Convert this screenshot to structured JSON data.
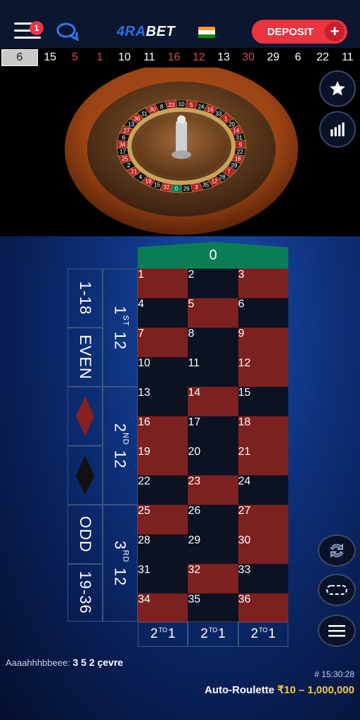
{
  "header": {
    "menu_badge": "1",
    "logo_prefix": "4RA",
    "logo_suffix": "BET",
    "deposit_label": "DEPOSIT",
    "deposit_plus": "+",
    "flag_colors": [
      "#ff9933",
      "#ffffff",
      "#138808"
    ]
  },
  "history": [
    {
      "v": "6",
      "c": "black"
    },
    {
      "v": "15",
      "c": "black"
    },
    {
      "v": "5",
      "c": "red"
    },
    {
      "v": "1",
      "c": "red"
    },
    {
      "v": "10",
      "c": "black"
    },
    {
      "v": "11",
      "c": "black"
    },
    {
      "v": "16",
      "c": "red"
    },
    {
      "v": "12",
      "c": "red"
    },
    {
      "v": "13",
      "c": "black"
    },
    {
      "v": "30",
      "c": "red"
    },
    {
      "v": "29",
      "c": "black"
    },
    {
      "v": "6",
      "c": "black"
    },
    {
      "v": "22",
      "c": "black"
    },
    {
      "v": "11",
      "c": "black"
    }
  ],
  "wheel": {
    "visible_numbers": [
      "10",
      "5",
      "24",
      "16",
      "33",
      "1",
      "20",
      "14",
      "31",
      "9",
      "22",
      "18",
      "29",
      "7",
      "28",
      "12",
      "35",
      "3",
      "26",
      "0",
      "32",
      "15",
      "19",
      "4",
      "21",
      "2",
      "25",
      "17",
      "34",
      "6",
      "27",
      "13",
      "36",
      "11",
      "30",
      "8",
      "23"
    ]
  },
  "table": {
    "zero": "0",
    "numbers": [
      {
        "n": "1",
        "c": "red"
      },
      {
        "n": "2",
        "c": "black"
      },
      {
        "n": "3",
        "c": "red"
      },
      {
        "n": "4",
        "c": "black"
      },
      {
        "n": "5",
        "c": "red"
      },
      {
        "n": "6",
        "c": "black"
      },
      {
        "n": "7",
        "c": "red"
      },
      {
        "n": "8",
        "c": "black"
      },
      {
        "n": "9",
        "c": "red"
      },
      {
        "n": "10",
        "c": "black"
      },
      {
        "n": "11",
        "c": "black"
      },
      {
        "n": "12",
        "c": "red"
      },
      {
        "n": "13",
        "c": "black"
      },
      {
        "n": "14",
        "c": "red"
      },
      {
        "n": "15",
        "c": "black"
      },
      {
        "n": "16",
        "c": "red"
      },
      {
        "n": "17",
        "c": "black"
      },
      {
        "n": "18",
        "c": "red"
      },
      {
        "n": "19",
        "c": "red"
      },
      {
        "n": "20",
        "c": "black"
      },
      {
        "n": "21",
        "c": "red"
      },
      {
        "n": "22",
        "c": "black"
      },
      {
        "n": "23",
        "c": "red"
      },
      {
        "n": "24",
        "c": "black"
      },
      {
        "n": "25",
        "c": "red"
      },
      {
        "n": "26",
        "c": "black"
      },
      {
        "n": "27",
        "c": "red"
      },
      {
        "n": "28",
        "c": "black"
      },
      {
        "n": "29",
        "c": "black"
      },
      {
        "n": "30",
        "c": "red"
      },
      {
        "n": "31",
        "c": "black"
      },
      {
        "n": "32",
        "c": "red"
      },
      {
        "n": "33",
        "c": "black"
      },
      {
        "n": "34",
        "c": "red"
      },
      {
        "n": "35",
        "c": "black"
      },
      {
        "n": "36",
        "c": "red"
      }
    ],
    "column_bet": {
      "pre": "2",
      "sup": "TO",
      "post": "1"
    },
    "dozens": [
      {
        "num": "1",
        "sup": "ST",
        "label": "12"
      },
      {
        "num": "2",
        "sup": "ND",
        "label": "12"
      },
      {
        "num": "3",
        "sup": "RD",
        "label": "12"
      }
    ],
    "low": "1-18",
    "even": "EVEN",
    "odd": "ODD",
    "high": "19-36",
    "colors": {
      "red": "#7c2120",
      "black": "#0c1222",
      "green": "#0b7d55",
      "border": "#3a5680"
    }
  },
  "chat": {
    "user": "Aaaahhhbbeee:",
    "message": "3 5 2 çevre"
  },
  "game": {
    "id": "# 15:30:28",
    "name": "Auto-Roulette",
    "limits": "₹10 – 1,000,000"
  },
  "icons": [
    "menu-icon",
    "chat-icon",
    "star-icon",
    "stats-icon",
    "repeat-icon",
    "racetrack-icon",
    "hamburger-icon"
  ]
}
